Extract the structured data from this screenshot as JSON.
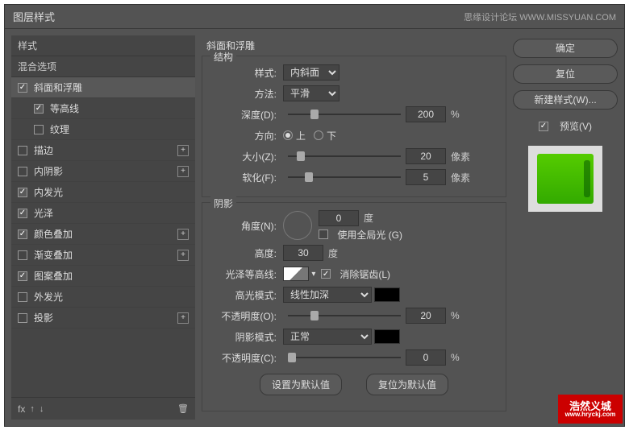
{
  "titlebar": {
    "title": "图层样式",
    "credit": "思缘设计论坛  WWW.MISSYUAN.COM"
  },
  "left": {
    "header": "样式",
    "blend": "混合选项",
    "items": [
      {
        "label": "斜面和浮雕",
        "checked": true,
        "selected": true,
        "plus": false
      },
      {
        "label": "等高线",
        "checked": true,
        "sub": true
      },
      {
        "label": "纹理",
        "checked": false,
        "sub": true
      },
      {
        "label": "描边",
        "checked": false,
        "plus": true
      },
      {
        "label": "内阴影",
        "checked": false,
        "plus": true
      },
      {
        "label": "内发光",
        "checked": true
      },
      {
        "label": "光泽",
        "checked": true
      },
      {
        "label": "颜色叠加",
        "checked": true,
        "plus": true
      },
      {
        "label": "渐变叠加",
        "checked": false,
        "plus": true
      },
      {
        "label": "图案叠加",
        "checked": true
      },
      {
        "label": "外发光",
        "checked": false
      },
      {
        "label": "投影",
        "checked": false,
        "plus": true
      }
    ],
    "footer_fx": "fx"
  },
  "center": {
    "title": "斜面和浮雕",
    "structure": {
      "legend": "结构",
      "style_label": "样式:",
      "style_value": "内斜面",
      "method_label": "方法:",
      "method_value": "平滑",
      "depth_label": "深度(D):",
      "depth_value": "200",
      "depth_unit": "%",
      "direction_label": "方向:",
      "up": "上",
      "down": "下",
      "size_label": "大小(Z):",
      "size_value": "20",
      "size_unit": "像素",
      "soften_label": "软化(F):",
      "soften_value": "5",
      "soften_unit": "像素"
    },
    "shading": {
      "legend": "阴影",
      "angle_label": "角度(N):",
      "angle_value": "0",
      "angle_unit": "度",
      "global_label": "使用全局光 (G)",
      "altitude_label": "高度:",
      "altitude_value": "30",
      "altitude_unit": "度",
      "gloss_label": "光泽等高线:",
      "antialias_label": "消除锯齿(L)",
      "highlight_mode_label": "高光模式:",
      "highlight_mode_value": "线性加深",
      "highlight_opacity_label": "不透明度(O):",
      "highlight_opacity_value": "20",
      "opacity_unit": "%",
      "shadow_mode_label": "阴影模式:",
      "shadow_mode_value": "正常",
      "shadow_opacity_label": "不透明度(C):",
      "shadow_opacity_value": "0"
    },
    "buttons": {
      "default": "设置为默认值",
      "reset": "复位为默认值"
    }
  },
  "right": {
    "ok": "确定",
    "cancel": "复位",
    "new_style": "新建样式(W)...",
    "preview_label": "预览(V)"
  },
  "logo": {
    "top": "浩然义城",
    "sub": "www.hryckj.com"
  }
}
